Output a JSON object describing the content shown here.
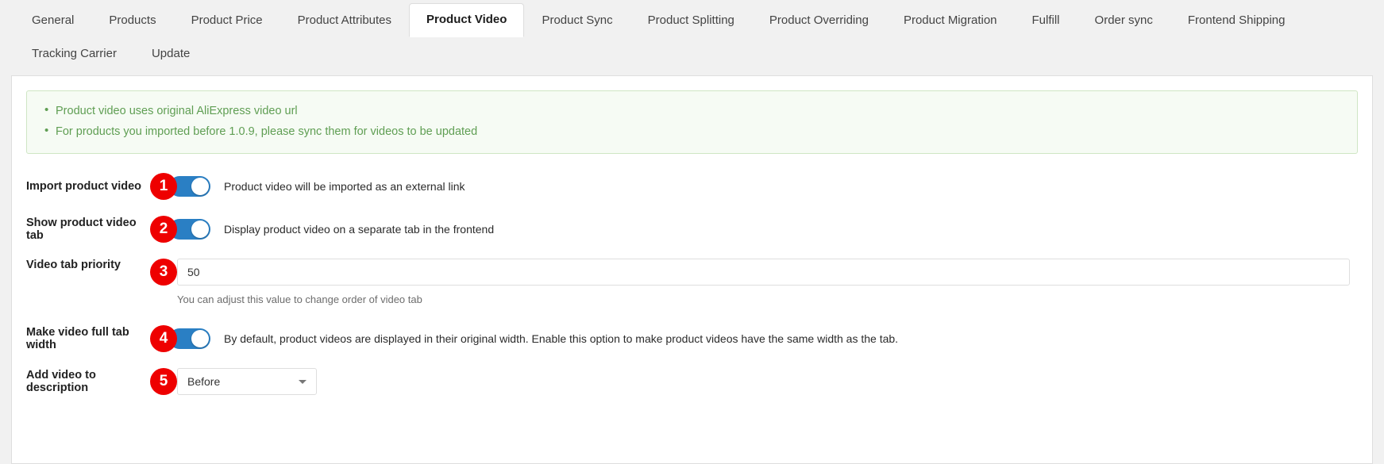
{
  "tabs": [
    {
      "label": "General",
      "active": false
    },
    {
      "label": "Products",
      "active": false
    },
    {
      "label": "Product Price",
      "active": false
    },
    {
      "label": "Product Attributes",
      "active": false
    },
    {
      "label": "Product Video",
      "active": true
    },
    {
      "label": "Product Sync",
      "active": false
    },
    {
      "label": "Product Splitting",
      "active": false
    },
    {
      "label": "Product Overriding",
      "active": false
    },
    {
      "label": "Product Migration",
      "active": false
    },
    {
      "label": "Fulfill",
      "active": false
    },
    {
      "label": "Order sync",
      "active": false
    },
    {
      "label": "Frontend Shipping",
      "active": false
    },
    {
      "label": "Tracking Carrier",
      "active": false
    },
    {
      "label": "Update",
      "active": false
    }
  ],
  "notice": {
    "items": [
      "Product video uses original AliExpress video url",
      "For products you imported before 1.0.9, please sync them for videos to be updated"
    ],
    "background_color": "#f6fbf4",
    "border_color": "#cfe6c4",
    "text_color": "#5f9e53"
  },
  "colors": {
    "badge": "#ee0000",
    "toggle_on": "#2a7fc4",
    "panel_background": "#ffffff",
    "page_background": "#f1f1f1"
  },
  "rows": [
    {
      "badge": "1",
      "label": "Import product video",
      "control": "toggle",
      "toggle_state": "on",
      "description": "Product video will be imported as an external link"
    },
    {
      "badge": "2",
      "label": "Show product video tab",
      "control": "toggle",
      "toggle_state": "on",
      "description": "Display product video on a separate tab in the frontend"
    },
    {
      "badge": "3",
      "label": "Video tab priority",
      "control": "text",
      "value": "50",
      "placeholder": "",
      "help": "You can adjust this value to change order of video tab"
    },
    {
      "badge": "4",
      "label": "Make video full tab width",
      "control": "toggle",
      "toggle_state": "on",
      "description": "By default, product videos are displayed in their original width. Enable this option to make product videos have the same width as the tab."
    },
    {
      "badge": "5",
      "label": "Add video to description",
      "control": "select",
      "value": "Before",
      "options": [
        "Before"
      ]
    }
  ]
}
